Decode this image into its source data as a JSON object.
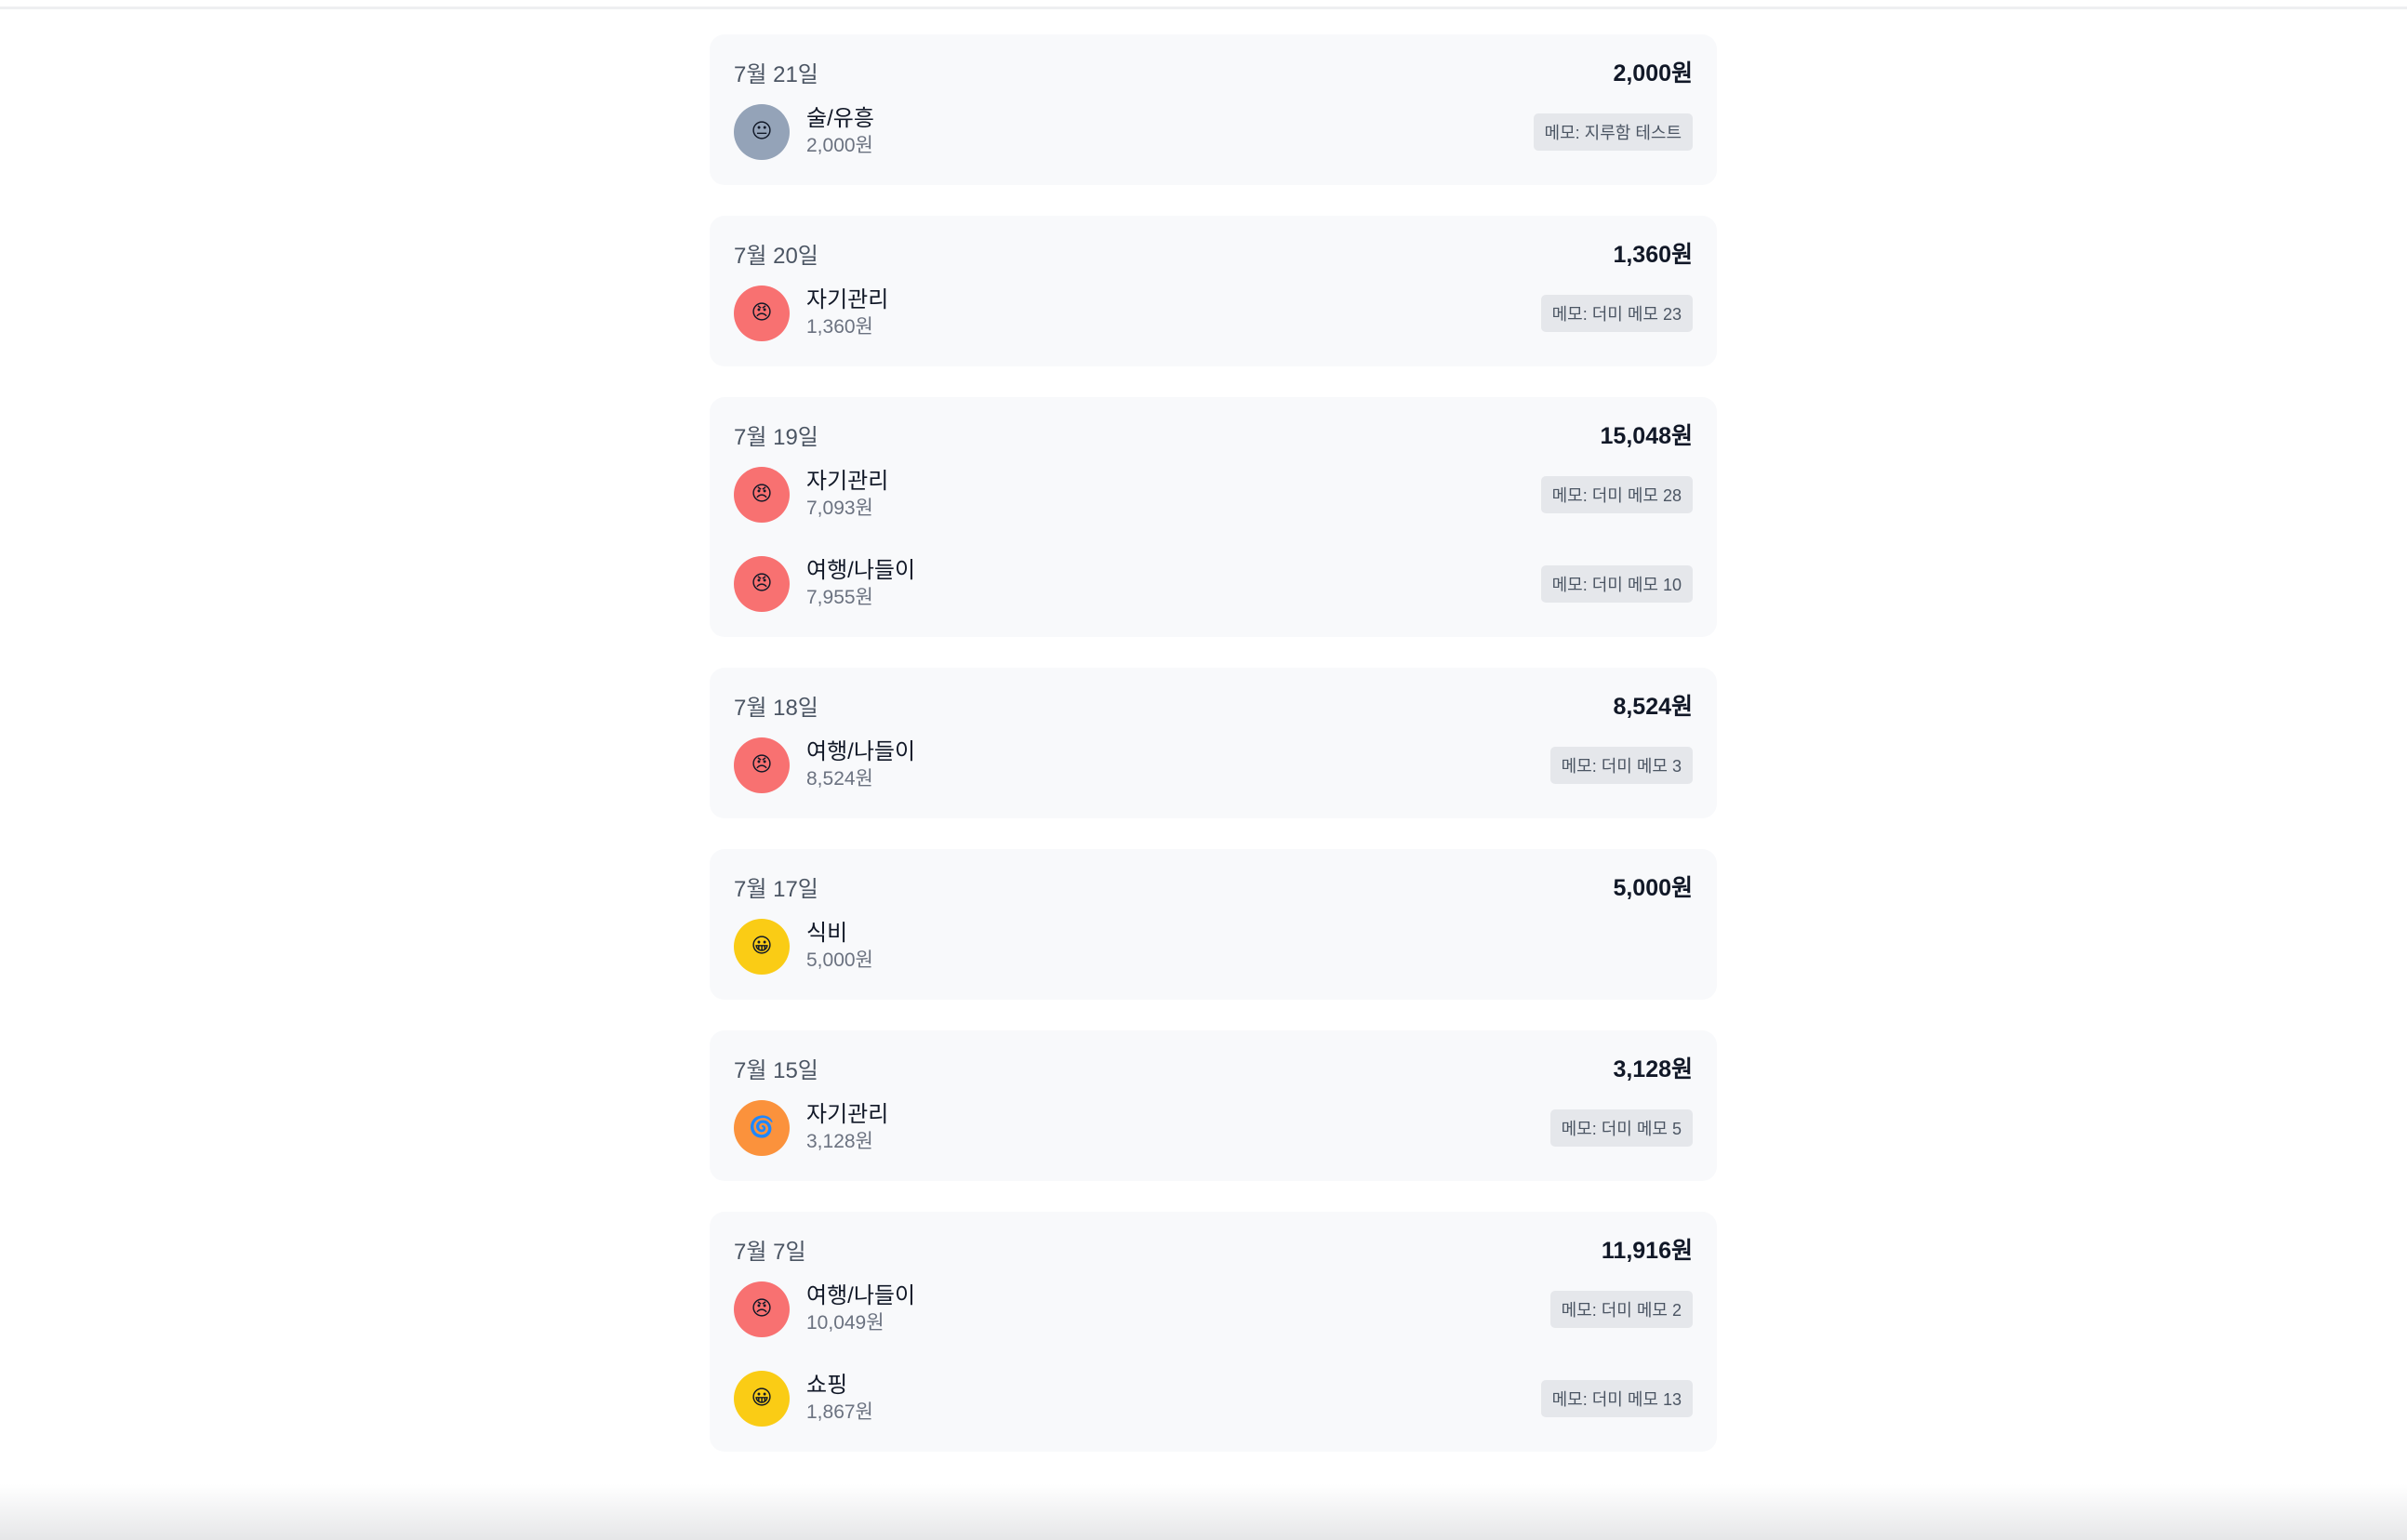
{
  "colors": {
    "card_bg": "#f8f9fb",
    "memo_bg": "#e5e7eb",
    "mood_gray": "#94a3b8",
    "mood_red": "#f87171",
    "mood_yellow": "#facc15",
    "mood_orange": "#fb923c"
  },
  "days": [
    {
      "date": "7월 21일",
      "total": "2,000원",
      "entries": [
        {
          "category": "술/유흥",
          "amount": "2,000원",
          "memo": "메모: 지루함 테스트",
          "mood_icon": "neutral-face-icon",
          "mood_glyph": "😐",
          "mood_color": "#94a3b8"
        }
      ]
    },
    {
      "date": "7월 20일",
      "total": "1,360원",
      "entries": [
        {
          "category": "자기관리",
          "amount": "1,360원",
          "memo": "메모: 더미 메모 23",
          "mood_icon": "angry-face-icon",
          "mood_glyph": "😠",
          "mood_color": "#f87171"
        }
      ]
    },
    {
      "date": "7월 19일",
      "total": "15,048원",
      "entries": [
        {
          "category": "자기관리",
          "amount": "7,093원",
          "memo": "메모: 더미 메모 28",
          "mood_icon": "angry-face-icon",
          "mood_glyph": "😠",
          "mood_color": "#f87171"
        },
        {
          "category": "여행/나들이",
          "amount": "7,955원",
          "memo": "메모: 더미 메모 10",
          "mood_icon": "angry-face-icon",
          "mood_glyph": "😠",
          "mood_color": "#f87171"
        }
      ]
    },
    {
      "date": "7월 18일",
      "total": "8,524원",
      "entries": [
        {
          "category": "여행/나들이",
          "amount": "8,524원",
          "memo": "메모: 더미 메모 3",
          "mood_icon": "angry-face-icon",
          "mood_glyph": "😠",
          "mood_color": "#f87171"
        }
      ]
    },
    {
      "date": "7월 17일",
      "total": "5,000원",
      "entries": [
        {
          "category": "식비",
          "amount": "5,000원",
          "memo": "",
          "mood_icon": "grinning-face-icon",
          "mood_glyph": "😀",
          "mood_color": "#facc15"
        }
      ]
    },
    {
      "date": "7월 15일",
      "total": "3,128원",
      "entries": [
        {
          "category": "자기관리",
          "amount": "3,128원",
          "memo": "메모: 더미 메모 5",
          "mood_icon": "dizzy-spiral-icon",
          "mood_glyph": "🌀",
          "mood_color": "#fb923c"
        }
      ]
    },
    {
      "date": "7월 7일",
      "total": "11,916원",
      "entries": [
        {
          "category": "여행/나들이",
          "amount": "10,049원",
          "memo": "메모: 더미 메모 2",
          "mood_icon": "angry-face-icon",
          "mood_glyph": "😠",
          "mood_color": "#f87171"
        },
        {
          "category": "쇼핑",
          "amount": "1,867원",
          "memo": "메모: 더미 메모 13",
          "mood_icon": "grinning-face-icon",
          "mood_glyph": "😀",
          "mood_color": "#facc15"
        }
      ]
    }
  ]
}
